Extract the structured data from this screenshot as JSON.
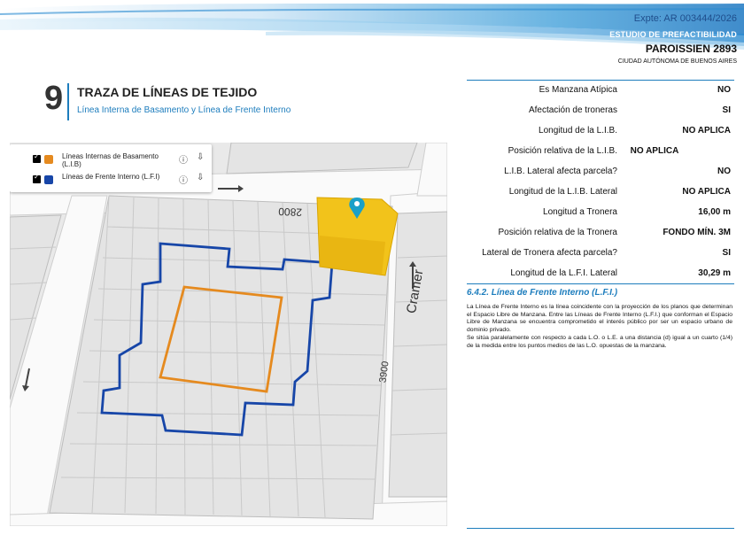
{
  "header": {
    "expediente": "Expte: AR 003444/2026",
    "estudio": "ESTUDIO DE PREFACTIBILIDAD",
    "direccion": "PAROISSIEN 2893",
    "ciudad": "CIUDAD AUTÓNOMA DE BUENOS AIRES"
  },
  "section": {
    "number": "9",
    "title": "TRAZA DE LÍNEAS DE TEJIDO",
    "subtitle": "Línea Interna de Basamento y Línea de Frente Interno"
  },
  "map": {
    "street_top_number": "2800",
    "street_right_name": "Cramer",
    "street_right_number": "3900",
    "legend": [
      {
        "label": "Líneas Internas de Basamento (L.I.B)",
        "color": "#e58a1f"
      },
      {
        "label": "Líneas de Frente Interno (L.F.I)",
        "color": "#1746a8"
      }
    ],
    "icons": {
      "info": "ⓘ",
      "download": "⇩"
    },
    "colors": {
      "parcel": "#f2c31b",
      "lib": "#e58a1f",
      "lfi": "#1746a8",
      "pin": "#1aa0c8"
    }
  },
  "table": [
    {
      "label": "Es Manzana Atípica",
      "value": "NO"
    },
    {
      "label": "Afectación de troneras",
      "value": "SI"
    },
    {
      "label": "Longitud de la L.I.B.",
      "value": "NO APLICA"
    },
    {
      "label": "Posición relativa de la L.I.B.",
      "value": "NO APLICA"
    },
    {
      "label": "L.I.B. Lateral afecta parcela?",
      "value": "NO"
    },
    {
      "label": "Longitud de la L.I.B. Lateral",
      "value": "NO APLICA"
    },
    {
      "label": "Longitud a Tronera",
      "value": "16,00 m"
    },
    {
      "label": "Posición relativa de la Tronera",
      "value": "FONDO MÍN. 3M"
    },
    {
      "label": "Lateral de Tronera afecta parcela?",
      "value": "SI"
    },
    {
      "label": "Longitud de la L.F.I. Lateral",
      "value": "30,29 m"
    }
  ],
  "lfi": {
    "heading": "6.4.2. Línea de Frente Interno (L.F.I.)",
    "paragraph1": "La Línea de Frente Interno es la línea coincidente con la proyección de los planos que determinan el Espacio Libre de Manzana. Entre las Líneas de Frente Interno (L.F.I.) que conforman el Espacio Libre de Manzana se encuentra comprometido el interés público por ser un espacio urbano de dominio privado.",
    "paragraph2": "Se sitúa paralelamente con respecto a cada L.O. o L.E. a una distancia (d) igual a un cuarto (1/4) de la medida entre los puntos medios de las L.O. opuestas de la manzana."
  }
}
